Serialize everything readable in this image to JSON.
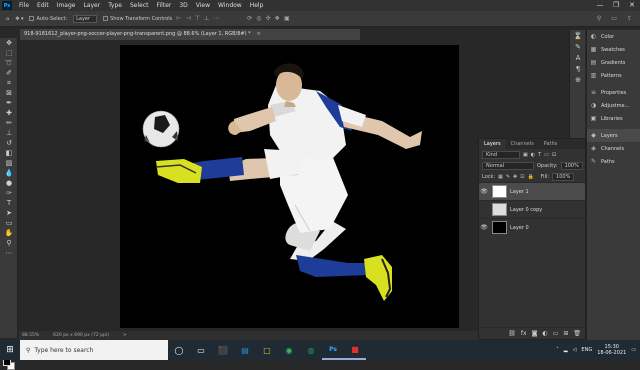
{
  "menu": {
    "logo": "Ps",
    "items": [
      "File",
      "Edit",
      "Image",
      "Layer",
      "Type",
      "Select",
      "Filter",
      "3D",
      "View",
      "Window",
      "Help"
    ],
    "window_controls": [
      "—",
      "❐",
      "✕"
    ]
  },
  "options_bar": {
    "auto_select_label": "Auto-Select:",
    "auto_select_value": "Layer",
    "transform_label": "Show Transform Controls"
  },
  "document_tab": {
    "title": "918-9181612_player-png-soccer-player-png-transparent.png @ 88.6% (Layer 1, RGB/8#) *",
    "close": "×"
  },
  "status_bar": {
    "zoom": "88.55%",
    "dimensions": "620 px x 690 px (72 ppi)",
    "arrow": ">"
  },
  "dock": {
    "items": [
      {
        "label": "Color",
        "icon": "◐"
      },
      {
        "label": "Swatches",
        "icon": "▦"
      },
      {
        "label": "Gradients",
        "icon": "▤"
      },
      {
        "label": "Patterns",
        "icon": "▥"
      },
      {
        "label": "Properties",
        "icon": "≡"
      },
      {
        "label": "Adjustme...",
        "icon": "◑"
      },
      {
        "label": "Libraries",
        "icon": "▣"
      },
      {
        "label": "Layers",
        "icon": "◆"
      },
      {
        "label": "Channels",
        "icon": "◈"
      },
      {
        "label": "Paths",
        "icon": "✎"
      }
    ]
  },
  "layers_panel": {
    "tabs": [
      "Layers",
      "Channels",
      "Paths"
    ],
    "filter_value": "Kind",
    "blend_mode": "Normal",
    "opacity_label": "Opacity:",
    "opacity_value": "100%",
    "lock_label": "Lock:",
    "fill_label": "Fill:",
    "fill_value": "100%",
    "layers": [
      {
        "name": "Layer 1",
        "visible": true,
        "selected": true
      },
      {
        "name": "Layer 0 copy",
        "visible": false,
        "selected": false
      },
      {
        "name": "Layer 0",
        "visible": true,
        "selected": false
      }
    ],
    "footer_icons": [
      "⛓",
      "fx",
      "◙",
      "◐",
      "▭",
      "⊞",
      "🗑"
    ]
  },
  "taskbar": {
    "start_icon": "⊞",
    "search_placeholder": "Type here to search",
    "apps": [
      "◯",
      "▭",
      "⬛",
      "▤",
      "▢",
      "◉",
      "◍",
      "Ps",
      "■"
    ],
    "tray_lang": "ENG",
    "time": "15:30",
    "date": "18-06-2021"
  },
  "colors": {
    "accent": "#31a8ff",
    "jersey_blue": "#1d3d99",
    "boot_yellow": "#d8e020"
  }
}
